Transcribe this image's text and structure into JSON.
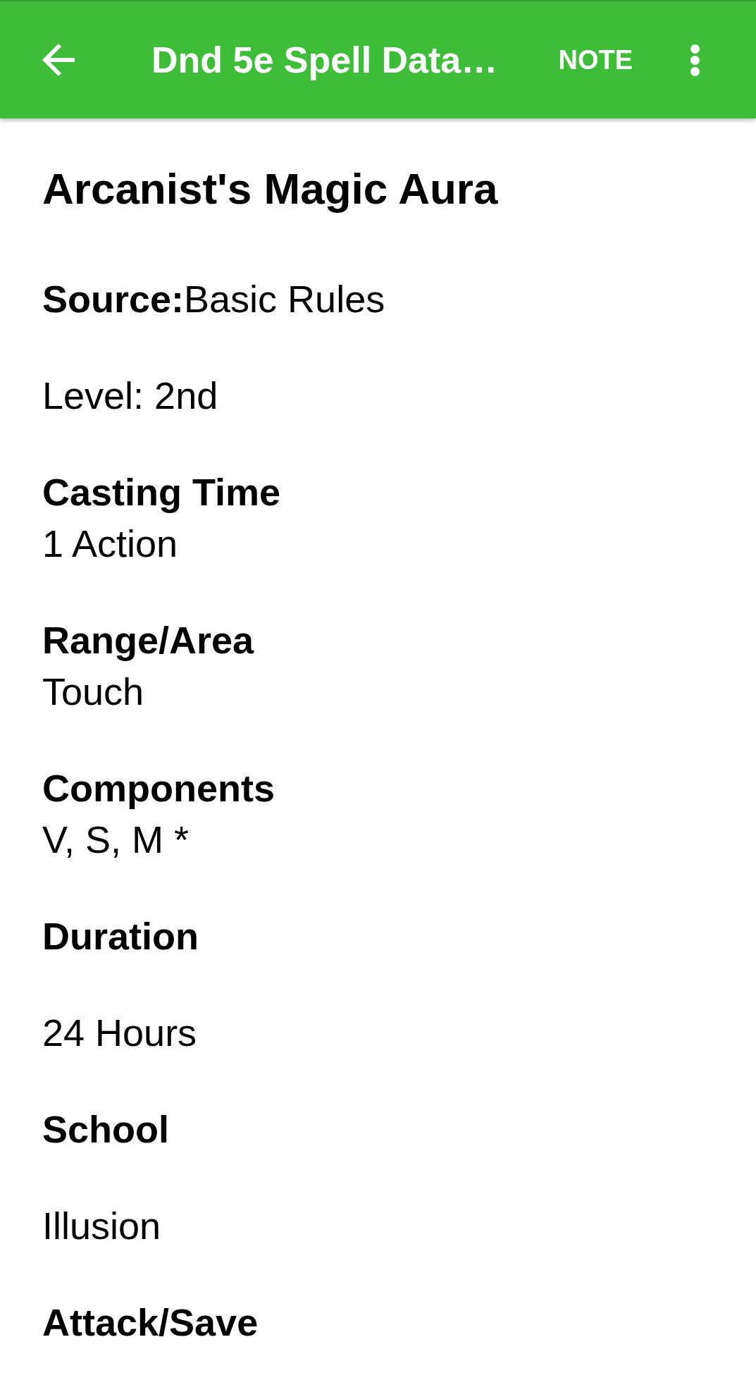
{
  "app_bar": {
    "title": "Dnd 5e Spell Data…",
    "action": "NOTE"
  },
  "spell": {
    "name": "Arcanist's Magic Aura",
    "details": [
      {
        "kind": "paragraph",
        "text": "**Source:**Basic Rules"
      },
      {
        "kind": "paragraph",
        "text": "Level: 2nd"
      },
      {
        "kind": "stacked",
        "label": "Casting Time",
        "value": "1 Action"
      },
      {
        "kind": "stacked",
        "label": "Range/Area",
        "value": "Touch"
      },
      {
        "kind": "stacked",
        "label": "Components",
        "value": "V, S, M *"
      },
      {
        "kind": "spaced",
        "label": "Duration",
        "value": "24 Hours"
      },
      {
        "kind": "spaced",
        "label": "School",
        "value": "Illusion"
      },
      {
        "kind": "heading",
        "label": "Attack/Save"
      }
    ]
  }
}
